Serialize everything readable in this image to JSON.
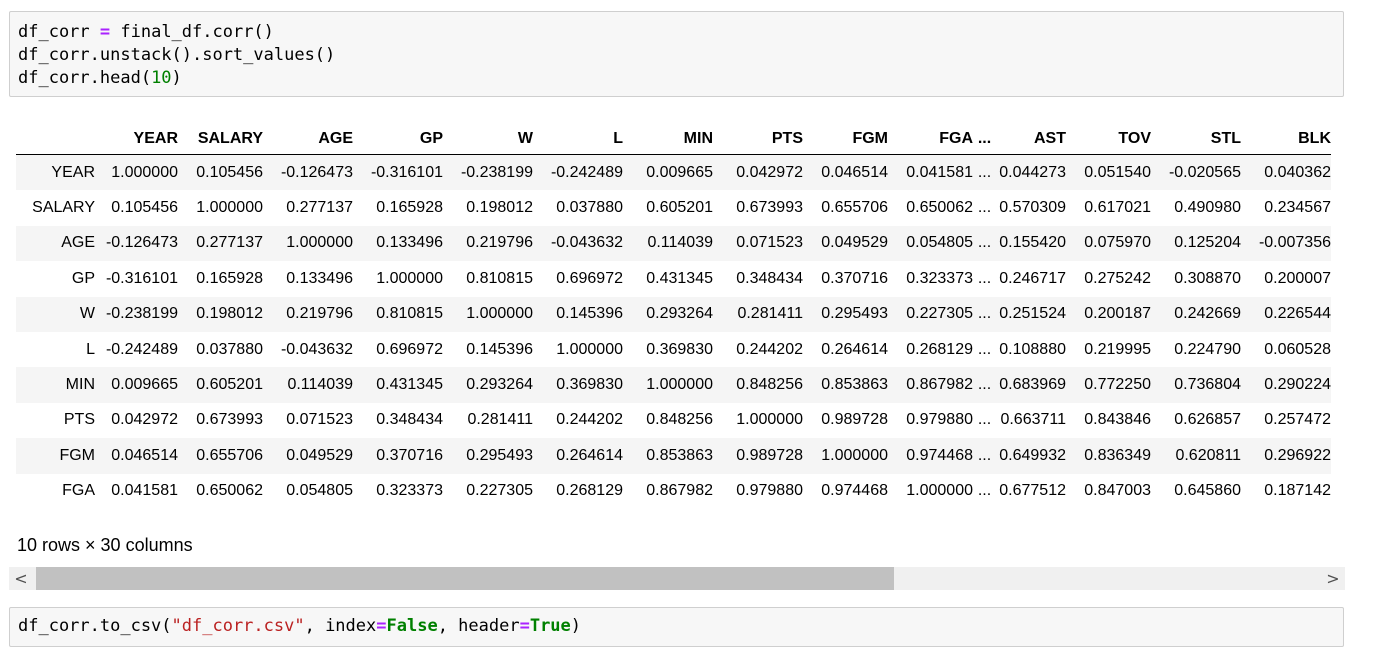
{
  "cell1": {
    "lines": [
      [
        {
          "t": "df_corr ",
          "c": ""
        },
        {
          "t": "=",
          "c": "op"
        },
        {
          "t": " final_df.corr()",
          "c": ""
        }
      ],
      [
        {
          "t": "df_corr.unstack().sort_values()",
          "c": ""
        }
      ],
      [
        {
          "t": "df_corr.head(",
          "c": ""
        },
        {
          "t": "10",
          "c": "num"
        },
        {
          "t": ")",
          "c": ""
        }
      ]
    ]
  },
  "table": {
    "columns": [
      "YEAR",
      "SALARY",
      "AGE",
      "GP",
      "W",
      "L",
      "MIN",
      "PTS",
      "FGM",
      "FGA",
      "...",
      "AST",
      "TOV",
      "STL",
      "BLK"
    ],
    "rows": [
      {
        "index": "YEAR",
        "values": [
          "1.000000",
          "0.105456",
          "-0.126473",
          "-0.316101",
          "-0.238199",
          "-0.242489",
          "0.009665",
          "0.042972",
          "0.046514",
          "0.041581",
          "...",
          "0.044273",
          "0.051540",
          "-0.020565",
          "0.040362"
        ]
      },
      {
        "index": "SALARY",
        "values": [
          "0.105456",
          "1.000000",
          "0.277137",
          "0.165928",
          "0.198012",
          "0.037880",
          "0.605201",
          "0.673993",
          "0.655706",
          "0.650062",
          "...",
          "0.570309",
          "0.617021",
          "0.490980",
          "0.234567"
        ]
      },
      {
        "index": "AGE",
        "values": [
          "-0.126473",
          "0.277137",
          "1.000000",
          "0.133496",
          "0.219796",
          "-0.043632",
          "0.114039",
          "0.071523",
          "0.049529",
          "0.054805",
          "...",
          "0.155420",
          "0.075970",
          "0.125204",
          "-0.007356"
        ]
      },
      {
        "index": "GP",
        "values": [
          "-0.316101",
          "0.165928",
          "0.133496",
          "1.000000",
          "0.810815",
          "0.696972",
          "0.431345",
          "0.348434",
          "0.370716",
          "0.323373",
          "...",
          "0.246717",
          "0.275242",
          "0.308870",
          "0.200007"
        ]
      },
      {
        "index": "W",
        "values": [
          "-0.238199",
          "0.198012",
          "0.219796",
          "0.810815",
          "1.000000",
          "0.145396",
          "0.293264",
          "0.281411",
          "0.295493",
          "0.227305",
          "...",
          "0.251524",
          "0.200187",
          "0.242669",
          "0.226544"
        ]
      },
      {
        "index": "L",
        "values": [
          "-0.242489",
          "0.037880",
          "-0.043632",
          "0.696972",
          "0.145396",
          "1.000000",
          "0.369830",
          "0.244202",
          "0.264614",
          "0.268129",
          "...",
          "0.108880",
          "0.219995",
          "0.224790",
          "0.060528"
        ]
      },
      {
        "index": "MIN",
        "values": [
          "0.009665",
          "0.605201",
          "0.114039",
          "0.431345",
          "0.293264",
          "0.369830",
          "1.000000",
          "0.848256",
          "0.853863",
          "0.867982",
          "...",
          "0.683969",
          "0.772250",
          "0.736804",
          "0.290224"
        ]
      },
      {
        "index": "PTS",
        "values": [
          "0.042972",
          "0.673993",
          "0.071523",
          "0.348434",
          "0.281411",
          "0.244202",
          "0.848256",
          "1.000000",
          "0.989728",
          "0.979880",
          "...",
          "0.663711",
          "0.843846",
          "0.626857",
          "0.257472"
        ]
      },
      {
        "index": "FGM",
        "values": [
          "0.046514",
          "0.655706",
          "0.049529",
          "0.370716",
          "0.295493",
          "0.264614",
          "0.853863",
          "0.989728",
          "1.000000",
          "0.974468",
          "...",
          "0.649932",
          "0.836349",
          "0.620811",
          "0.296922"
        ]
      },
      {
        "index": "FGA",
        "values": [
          "0.041581",
          "0.650062",
          "0.054805",
          "0.323373",
          "0.227305",
          "0.268129",
          "0.867982",
          "0.979880",
          "0.974468",
          "1.000000",
          "...",
          "0.677512",
          "0.847003",
          "0.645860",
          "0.187142"
        ]
      }
    ]
  },
  "shape_text": "10 rows × 30 columns",
  "scrollbar": {
    "left_arrow": "<",
    "right_arrow": ">",
    "position": 0.0
  },
  "cell2": {
    "lines": [
      [
        {
          "t": "df_corr.to_csv(",
          "c": ""
        },
        {
          "t": "\"df_corr.csv\"",
          "c": "str"
        },
        {
          "t": ", index",
          "c": ""
        },
        {
          "t": "=",
          "c": "op"
        },
        {
          "t": "False",
          "c": "kw"
        },
        {
          "t": ", header",
          "c": ""
        },
        {
          "t": "=",
          "c": "op"
        },
        {
          "t": "True",
          "c": "kw"
        },
        {
          "t": ")",
          "c": ""
        }
      ]
    ]
  },
  "colors": {
    "operator": "#aa22ff",
    "number": "#008000",
    "string": "#ba2121",
    "keyword": "#008000",
    "cell_bg": "#f7f7f7",
    "row_stripe": "#f5f5f5"
  }
}
